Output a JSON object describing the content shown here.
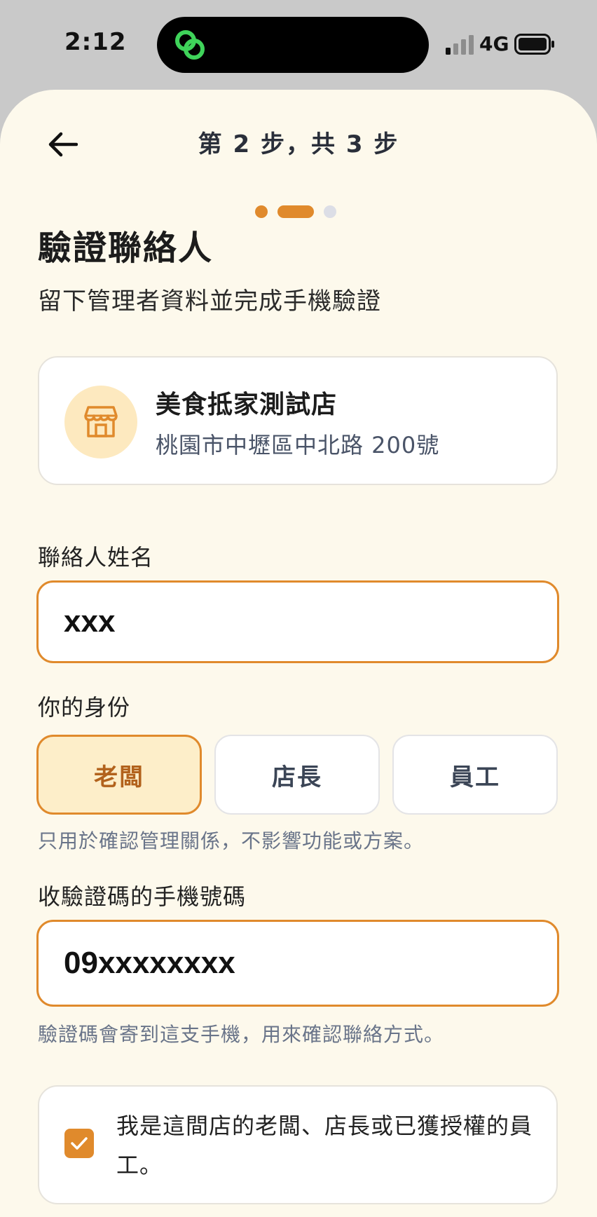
{
  "status_bar": {
    "time": "2:12",
    "network": "4G"
  },
  "header": {
    "step_title": "第 2 步，共 3 步"
  },
  "progress": {
    "current_step": 2,
    "total_steps": 3
  },
  "page": {
    "title": "驗證聯絡人",
    "subtitle": "留下管理者資料並完成手機驗證"
  },
  "store": {
    "name": "美食抵家測試店",
    "address": "桃園市中壢區中北路 200號",
    "icon": "store-icon"
  },
  "contact": {
    "label": "聯絡人姓名",
    "value": "xxx"
  },
  "role": {
    "label": "你的身份",
    "options": [
      "老闆",
      "店長",
      "員工"
    ],
    "selected": "老闆",
    "helper": "只用於確認管理關係，不影響功能或方案。"
  },
  "phone": {
    "label": "收驗證碼的手機號碼",
    "value": "09xxxxxxxx",
    "helper": "驗證碼會寄到這支手機，用來確認聯絡方式。"
  },
  "consent": {
    "checked": true,
    "text": "我是這間店的老闆、店長或已獲授權的員工。"
  },
  "colors": {
    "accent": "#e08a2c",
    "background": "#fdf9ec",
    "selected_bg": "#fdeec9"
  }
}
